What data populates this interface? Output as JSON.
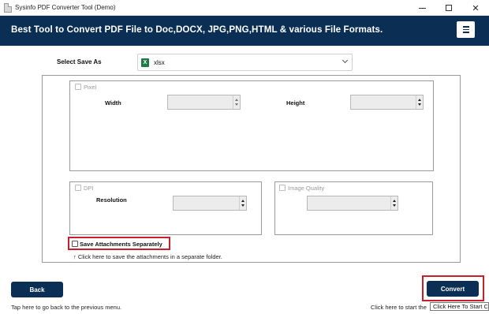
{
  "window": {
    "title": "Sysinfo PDF Converter Tool (Demo)",
    "minimize_glyph": "",
    "maximize_glyph": "",
    "close_glyph": "✕"
  },
  "banner": {
    "headline": "Best Tool to Convert PDF File to Doc,DOCX, JPG,PNG,HTML & various File Formats."
  },
  "save_as": {
    "label": "Select Save As",
    "icon": "excel-icon",
    "icon_glyph": "X",
    "value": "xlsx"
  },
  "pixel": {
    "checkbox_label": "Pixel",
    "checked": false,
    "width_label": "Width",
    "width_value": "",
    "height_label": "Height",
    "height_value": ""
  },
  "dpi": {
    "checkbox_label": "DPI",
    "checked": false,
    "resolution_label": "Resolution",
    "resolution_value": ""
  },
  "image_quality": {
    "checkbox_label": "Image Quality",
    "checked": false,
    "value": ""
  },
  "attachments": {
    "checkbox_label": "Save Attachments Separately",
    "checked": false,
    "hint": "↑ Click here to save the attachments in a separate folder."
  },
  "footer": {
    "back_label": "Back",
    "back_hint": "Tap here to go back to the previous menu.",
    "convert_label": "Convert",
    "convert_hint": "Click here to start the",
    "tooltip": "Click Here To Start Con",
    "highlight_color": "#c8202a",
    "accent_color": "#0b2e55"
  }
}
